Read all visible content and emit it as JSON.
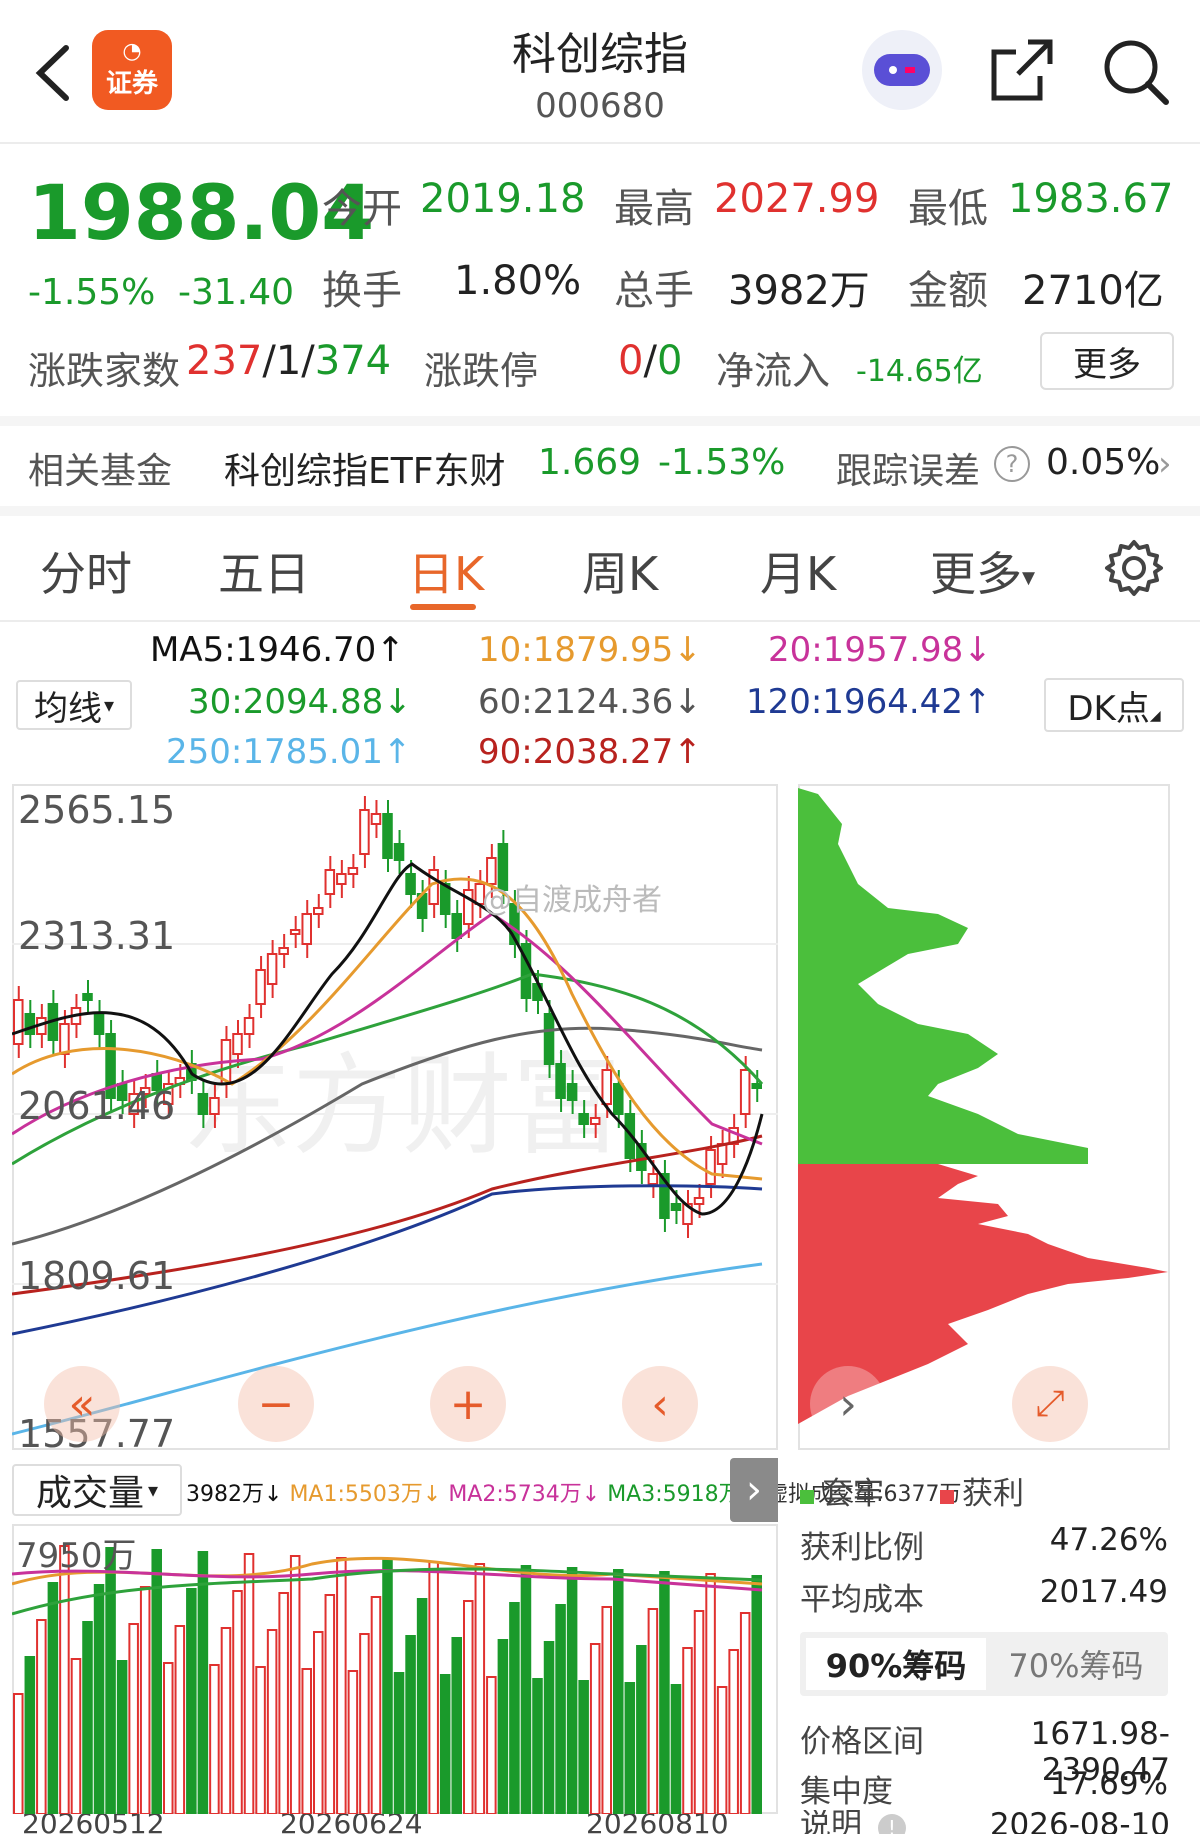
{
  "header": {
    "title": "科创综指",
    "code": "000680",
    "brand_badge": "证券"
  },
  "quote": {
    "price": "1988.04",
    "change_pct": "-1.55%",
    "change_abs": "-31.40",
    "open_label": "今开",
    "open": "2019.18",
    "high_label": "最高",
    "high": "2027.99",
    "low_label": "最低",
    "low": "1983.67",
    "turnover_label": "换手",
    "turnover": "1.80%",
    "volume_label": "总手",
    "volume": "3982万",
    "amount_label": "金额",
    "amount": "2710亿",
    "adv_label": "涨跌家数",
    "adv_up": "237",
    "adv_flat": "1",
    "adv_down": "374",
    "limit_label": "涨跌停",
    "limit_up": "0",
    "limit_down": "0",
    "netflow_label": "净流入",
    "netflow": "-14.65亿",
    "more_button": "更多"
  },
  "fund": {
    "label": "相关基金",
    "name": "科创综指ETF东财",
    "price": "1.669",
    "pct": "-1.53%",
    "tracking_label": "跟踪误差",
    "tracking_value": "0.05%"
  },
  "tabs": [
    "分时",
    "五日",
    "日K",
    "周K",
    "月K",
    "更多"
  ],
  "active_tab": "日K",
  "ma": {
    "ma5": "MA5:1946.70↑",
    "ma10": "10:1879.95↓",
    "ma20": "20:1957.98↓",
    "ma30": "30:2094.88↓",
    "ma60": "60:2124.36↓",
    "ma120": "120:1964.42↑",
    "ma250": "250:1785.01↑",
    "ma90": "90:2038.27↑",
    "line_selector": "均线",
    "dk_button": "DK点"
  },
  "price_axis": [
    "2565.15",
    "2313.31",
    "2061.46",
    "1809.61",
    "1557.77"
  ],
  "watermark": "@自渡成舟者",
  "volume": {
    "selector": "成交量",
    "readout": "3982万↓",
    "ma1": "MA1:5503万↓",
    "ma2": "MA2:5734万↓",
    "ma3": "MA3:5918万↓",
    "virtual": "虚拟成交量:6377万",
    "axis_top": "7950万"
  },
  "date_axis": [
    "20260512",
    "20260624",
    "20260810"
  ],
  "chips": {
    "legend_trapped": "套牢",
    "legend_profit": "获利",
    "profit_ratio_label": "获利比例",
    "profit_ratio": "47.26%",
    "avg_cost_label": "平均成本",
    "avg_cost": "2017.49",
    "tab90": "90%筹码",
    "tab70": "70%筹码",
    "range_label": "价格区间",
    "range": "1671.98-2390.47",
    "concentration_label": "集中度",
    "concentration": "17.69%",
    "note_label": "说明",
    "note_date": "2026-08-10"
  },
  "colors": {
    "up": "#e0312f",
    "down": "#1a9a2b",
    "accent": "#e8672a",
    "ma5": "#111111",
    "ma10": "#e69a2e",
    "ma20": "#c8329a",
    "ma30": "#2ea23b",
    "ma60": "#666666",
    "ma90": "#b8221e",
    "ma120": "#1f3a93",
    "ma250": "#5ab5e8"
  }
}
